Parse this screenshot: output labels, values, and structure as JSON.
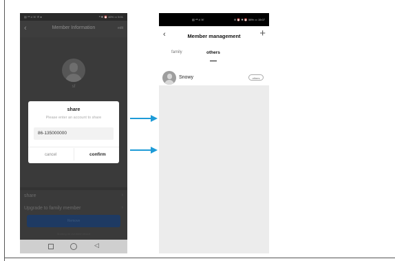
{
  "left_phone": {
    "status_left": "▤ ⁴ᴳ.ıl ☏ ✆ ●",
    "status_right": "ᴺ ✱ ⏰ 46% ▭ 5:01",
    "header": {
      "back": "‹",
      "title": "Member Information",
      "edit": "edit"
    },
    "member_name": "sf",
    "list_items": [
      {
        "label": "share",
        "chevron": "›"
      },
      {
        "label": "Upgrade to family member",
        "chevron": "›"
      }
    ],
    "primary_button": "Remove",
    "bottom_note": "Sharing an overtime device",
    "dialog": {
      "title": "share",
      "subtitle": "Please enter an account to share",
      "input_value": "86-135000000",
      "cancel": "cancel",
      "confirm": "confirm"
    }
  },
  "right_phone": {
    "status_left": "▤ ⁴ᴳ.ıl ☏",
    "status_right": "⊕ ⏰ ✱ ⏰ 58% ▭ 15:07",
    "header": {
      "back": "‹",
      "title": "Member management",
      "add": "+"
    },
    "tabs": [
      {
        "label": "family",
        "selected": false
      },
      {
        "label": "others",
        "selected": true
      }
    ],
    "members": [
      {
        "name": "Snowy",
        "role": "others"
      }
    ]
  },
  "colors": {
    "arrow": "#1e9bd7",
    "dialog_bg": "#ffffff",
    "dark_overlay": "#3a3a3a"
  }
}
